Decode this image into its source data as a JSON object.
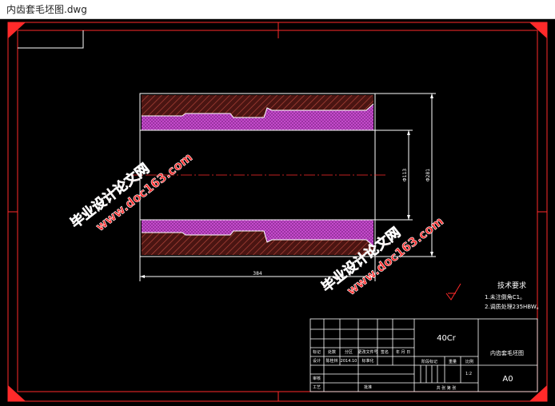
{
  "window": {
    "title": "内齿套毛坯图.dwg"
  },
  "colors": {
    "background": "#000000",
    "frame": "#ff2a2a",
    "line": "#ffffff",
    "hatch_pink": "#c03cc8",
    "hatch_brown": "#7a2420",
    "watermark": "#ff2a2a"
  },
  "drawing": {
    "dimensions": {
      "overall_length": "384",
      "inner_diameter": "Φ113",
      "outer_diameter": "Φ281"
    },
    "technical_requirements": {
      "heading": "技术要求",
      "items": [
        "1.未注倒角C1。",
        "2.调质处理235HBW。"
      ]
    },
    "watermarks": [
      {
        "line1": "毕业设计论文网",
        "line2": "www.doc163.com"
      },
      {
        "line1": "毕业设计论文网",
        "line2": "www.doc163.com"
      }
    ]
  },
  "title_block": {
    "material": "40Cr",
    "part_name": "内齿套毛坯图",
    "drawing_code": "A0",
    "scale": "1:2",
    "header_labels": [
      "标记",
      "处数",
      "分区",
      "更改文件号",
      "签名",
      "年 月 日"
    ],
    "row_design": [
      "设计",
      "陈桂林",
      "2014.10",
      "标准化"
    ],
    "row_review": "审核",
    "row_process": "工艺",
    "row_approve": "批准",
    "stage_label": "阶段标记",
    "weight_label": "重量",
    "ratio_label": "比例",
    "sheet_label": "共 张 第 张"
  }
}
